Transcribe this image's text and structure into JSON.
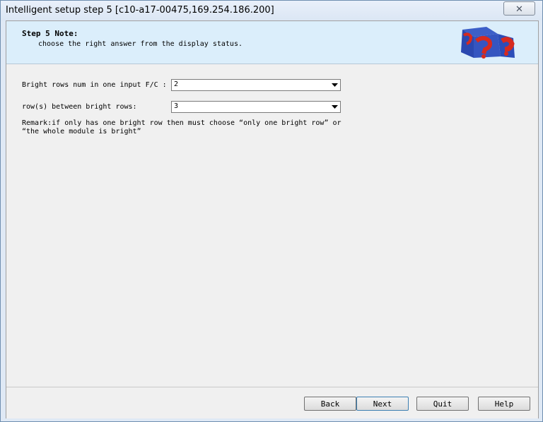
{
  "window": {
    "title": "Intelligent setup step 5 [c10-a17-00475,169.254.186.200]"
  },
  "note": {
    "title": "Step 5 Note:",
    "text": "choose the right answer from the display status."
  },
  "form": {
    "bright_rows_label": "Bright rows num in one input F/C :",
    "bright_rows_value": "2",
    "between_rows_label": "row(s) between bright rows:",
    "between_rows_value": "3",
    "remark_line1": "Remark:if only has one bright row then must choose “only one bright row” or",
    "remark_line2": "“the whole module is bright”"
  },
  "buttons": {
    "back": "Back",
    "next": "Next",
    "quit": "Quit",
    "help": "Help"
  },
  "icons": {
    "close": "close-icon",
    "dropdown": "chevron-down-icon",
    "logo": "help-cube-icon"
  }
}
